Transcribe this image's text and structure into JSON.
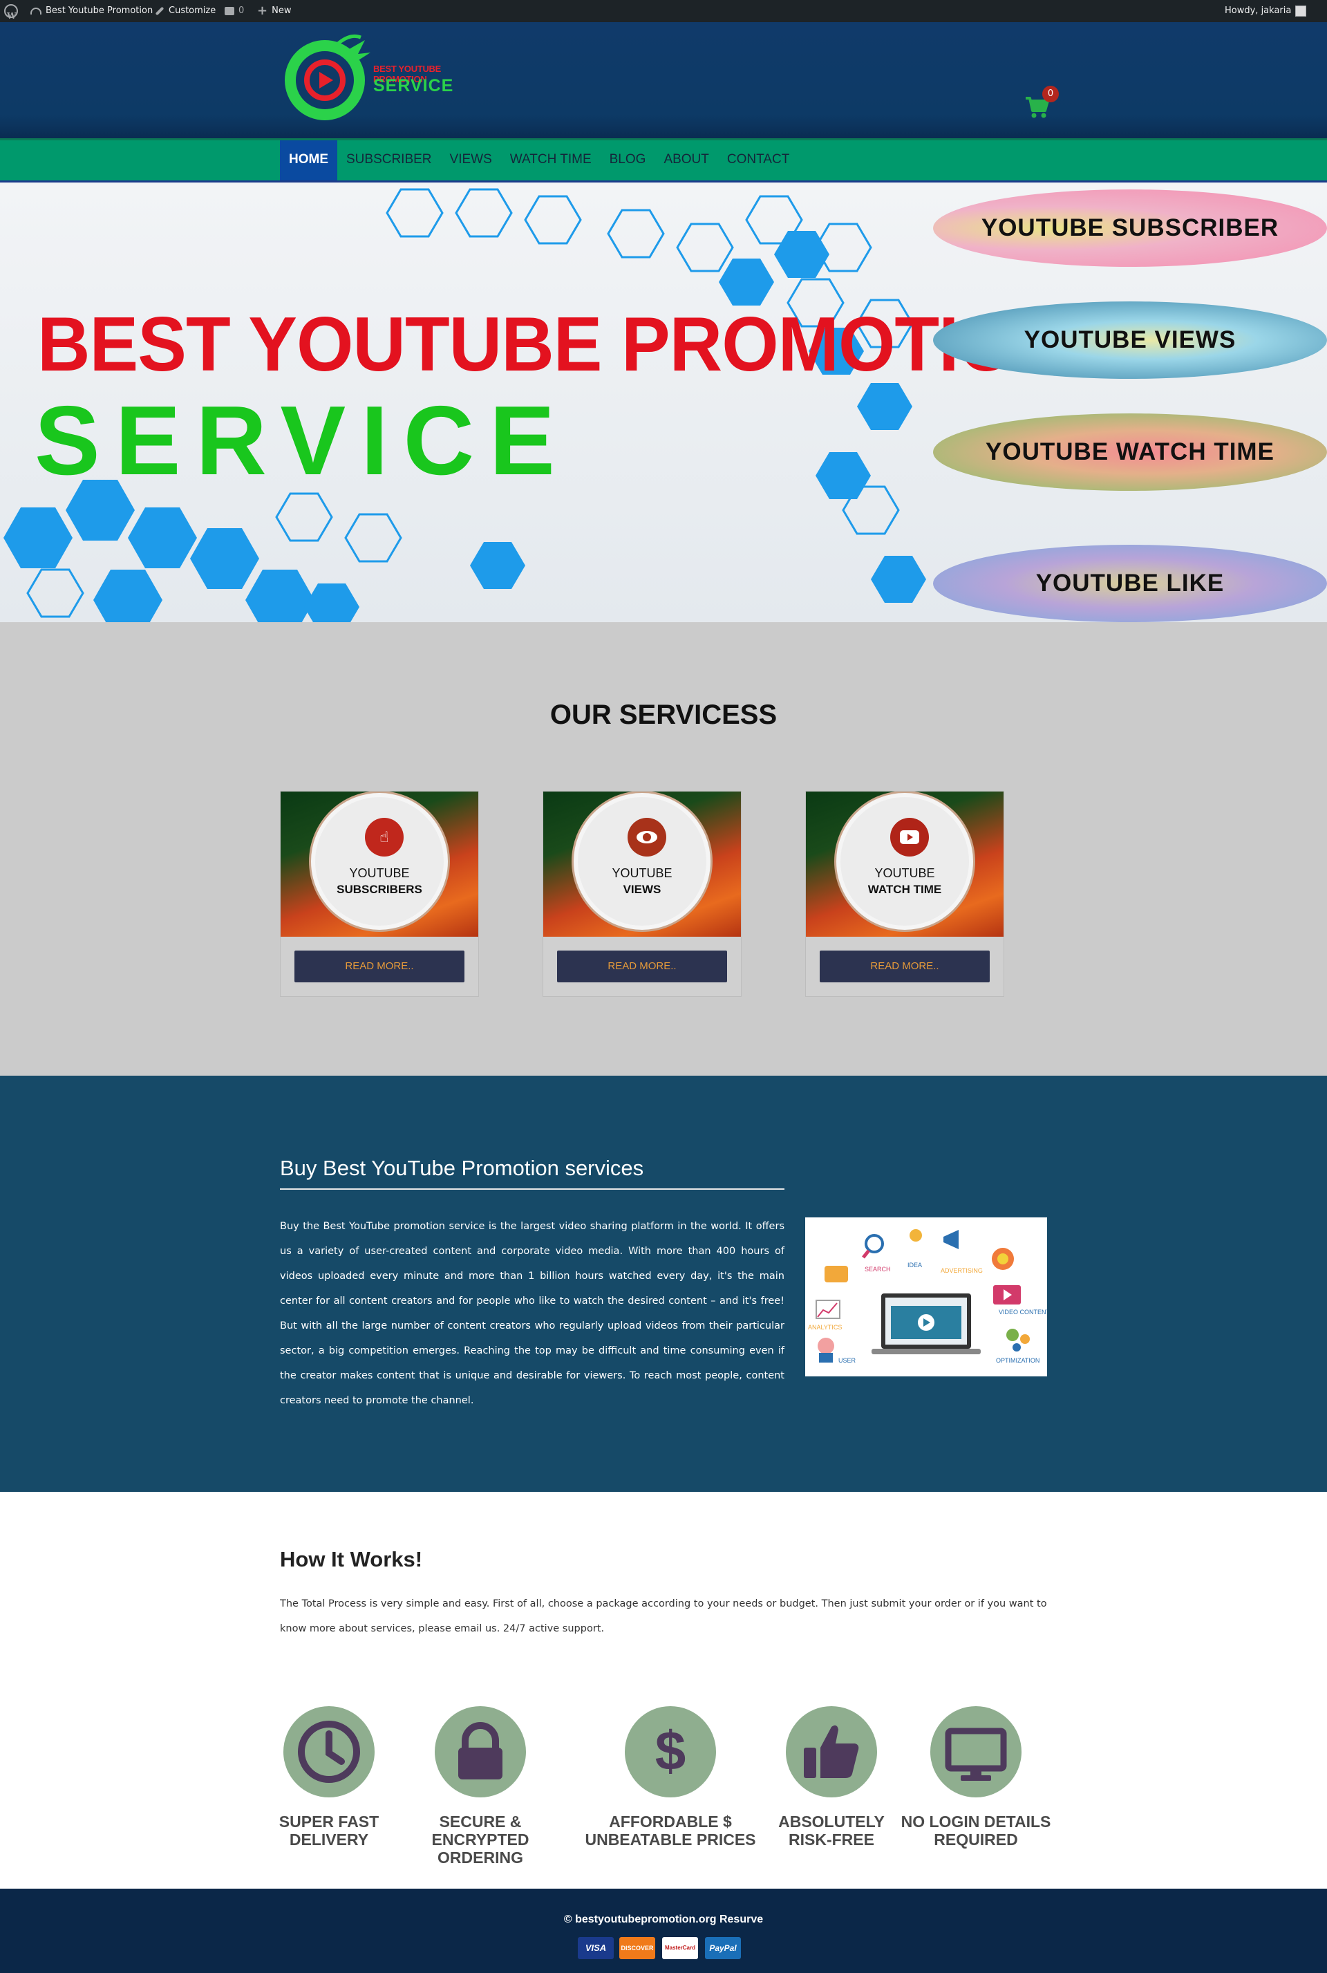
{
  "adminbar": {
    "site_name": "Best Youtube Promotion",
    "customize": "Customize",
    "comments_count": "0",
    "new_label": "New",
    "howdy": "Howdy, jakaria"
  },
  "header": {
    "logo_line1": "BEST YOUTUBE PROMOTION",
    "logo_line2": "SERVICE",
    "cart_count": "0"
  },
  "nav": {
    "items": [
      {
        "label": "HOME",
        "active": true
      },
      {
        "label": "SUBSCRIBER"
      },
      {
        "label": "VIEWS"
      },
      {
        "label": "WATCH TIME"
      },
      {
        "label": "BLOG"
      },
      {
        "label": "ABOUT"
      },
      {
        "label": "CONTACT"
      }
    ]
  },
  "hero": {
    "title_line1": "BEST YOUTUBE PROMOTION",
    "title_line2": "SERVICE",
    "pills": [
      "YOUTUBE SUBSCRIBER",
      "YOUTUBE VIEWS",
      "YOUTUBE WATCH TIME",
      "YOUTUBE LIKE"
    ]
  },
  "services": {
    "heading": "OUR SERVICESS",
    "cards": [
      {
        "line1": "YOUTUBE",
        "line2": "SUBSCRIBERS",
        "button": "READ MORE..",
        "icon": "pointer-icon"
      },
      {
        "line1": "YOUTUBE",
        "line2": "VIEWS",
        "button": "READ MORE..",
        "icon": "eye-icon"
      },
      {
        "line1": "YOUTUBE",
        "line2": "WATCH TIME",
        "button": "READ MORE..",
        "icon": "play-icon"
      }
    ]
  },
  "promo": {
    "heading": "Buy Best YouTube Promotion services",
    "body": "Buy the Best YouTube promotion service is the largest video sharing platform in the world. It offers us a variety of user-created content and corporate video media. With more than 400 hours of videos uploaded every minute and more than 1 billion hours watched every day, it's the main center for all content creators and for people who like to watch the desired content – and it's free! But with all the large number of content creators who regularly upload videos from their particular sector, a big competition emerges. Reaching the top may be difficult and time consuming even if the creator makes content that is unique and desirable for viewers. To reach most people, content creators need to promote the channel.",
    "image_labels": [
      "SEARCH",
      "IDEA",
      "ADVERTISING",
      "ANALYTICS",
      "VIDEO CONTENT",
      "USER",
      "OPTIMIZATION"
    ]
  },
  "how": {
    "heading": "How It Works!",
    "body": "The Total Process is very simple and easy. First of all, choose a package according to your needs or budget. Then just submit your order or if you want to know more about services, please email us. 24/7 active support.",
    "features": [
      {
        "line1": "SUPER FAST",
        "line2": "DELIVERY",
        "icon": "clock-icon"
      },
      {
        "line1": "SECURE & ENCRYPTED",
        "line2": "ORDERING",
        "icon": "lock-icon"
      },
      {
        "line1": "AFFORDABLE $",
        "line2": "UNBEATABLE PRICES",
        "icon": "dollar-icon"
      },
      {
        "line1": "ABSOLUTELY",
        "line2": "RISK-FREE",
        "icon": "thumbs-up-icon"
      },
      {
        "line1": "NO LOGIN DETAILS",
        "line2": "REQUIRED",
        "icon": "monitor-icon"
      }
    ]
  },
  "footer": {
    "copyright": "© bestyoutubepromotion.org Resurve",
    "payments": [
      "VISA",
      "DISCOVER",
      "MasterCard",
      "PayPal"
    ]
  },
  "colors": {
    "accent_green": "#00996c",
    "header_blue": "#103a6a",
    "promo_blue": "#164a68",
    "footer_navy": "#0b2748",
    "button_navy": "#2c3350",
    "button_text": "#e59a3a",
    "feature_circle": "#8fae8f"
  }
}
